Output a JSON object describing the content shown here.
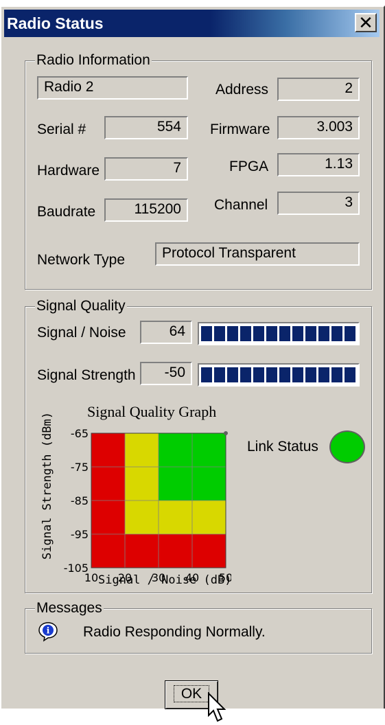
{
  "window": {
    "title": "Radio Status",
    "close_label": "✕"
  },
  "radio_info": {
    "legend": "Radio Information",
    "name_value": "Radio 2",
    "address_label": "Address",
    "address_value": "2",
    "serial_label": "Serial #",
    "serial_value": "554",
    "firmware_label": "Firmware",
    "firmware_value": "3.003",
    "hardware_label": "Hardware",
    "hardware_value": "7",
    "fpga_label": "FPGA",
    "fpga_value": "1.13",
    "baudrate_label": "Baudrate",
    "baudrate_value": "115200",
    "channel_label": "Channel",
    "channel_value": "3",
    "network_type_label": "Network Type",
    "network_type_value": "Protocol Transparent"
  },
  "signal_quality": {
    "legend": "Signal Quality",
    "snr_label": "Signal / Noise",
    "snr_value": "64",
    "snr_bar_fraction": 1.0,
    "strength_label": "Signal Strength",
    "strength_value": "-50",
    "strength_bar_fraction": 1.0,
    "link_status_label": "Link Status",
    "link_status_color": "#00cc00"
  },
  "chart_data": {
    "type": "heatmap",
    "title": "Signal Quality Graph",
    "xlabel": "Signal / Noise (dB)",
    "ylabel": "Signal Strength (dBm)",
    "x_ticks": [
      "10",
      "20",
      "30",
      "40",
      "50"
    ],
    "y_ticks": [
      "-65",
      "-75",
      "-85",
      "-95",
      "-105"
    ],
    "xlim": [
      10,
      50
    ],
    "ylim": [
      -105,
      -65
    ],
    "colors": {
      "red": "#dd0000",
      "yellow": "#d8d800",
      "green": "#00cc00"
    },
    "cells": [
      [
        "red",
        "yellow",
        "green",
        "green"
      ],
      [
        "red",
        "yellow",
        "green",
        "green"
      ],
      [
        "red",
        "yellow",
        "yellow",
        "yellow"
      ],
      [
        "red",
        "red",
        "red",
        "red"
      ]
    ],
    "row_bounds": [
      [
        -65,
        -75
      ],
      [
        -75,
        -85
      ],
      [
        -85,
        -95
      ],
      [
        -95,
        -105
      ]
    ],
    "col_bounds": [
      [
        10,
        20
      ],
      [
        20,
        30
      ],
      [
        30,
        40
      ],
      [
        40,
        50
      ]
    ],
    "current_point": {
      "x": 50,
      "y": -65
    }
  },
  "messages": {
    "legend": "Messages",
    "icon": "info-icon",
    "text": "Radio Responding Normally."
  },
  "footer": {
    "ok_label": "OK"
  }
}
